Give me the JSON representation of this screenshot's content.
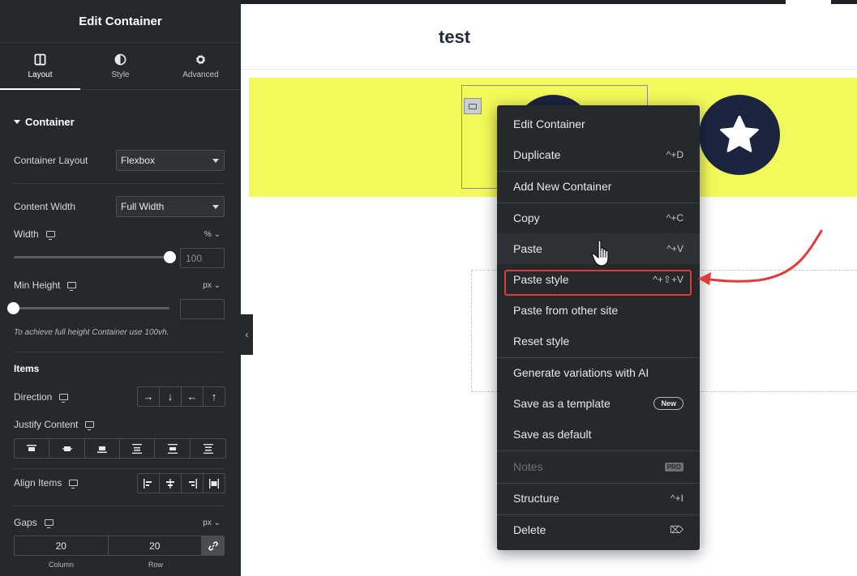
{
  "panel": {
    "title": "Edit Container",
    "tabs": [
      {
        "label": "Layout",
        "icon": "layout-icon"
      },
      {
        "label": "Style",
        "icon": "half-circle-icon"
      },
      {
        "label": "Advanced",
        "icon": "gear-icon"
      }
    ],
    "section": "Container",
    "container_layout": {
      "label": "Container Layout",
      "value": "Flexbox"
    },
    "content_width": {
      "label": "Content Width",
      "value": "Full Width"
    },
    "width": {
      "label": "Width",
      "unit": "%",
      "value": "100",
      "slider_fraction": 1.0
    },
    "min_height": {
      "label": "Min Height",
      "unit": "px",
      "value": "",
      "slider_fraction": 0.0
    },
    "hint": "To achieve full height Container use 100vh.",
    "items_heading": "Items",
    "direction_label": "Direction",
    "direction_options": [
      "→",
      "↓",
      "←",
      "↑"
    ],
    "justify_label": "Justify Content",
    "align_label": "Align Items",
    "gaps": {
      "label": "Gaps",
      "unit": "px",
      "column": "20",
      "row": "20",
      "column_label": "Column",
      "row_label": "Row"
    }
  },
  "canvas": {
    "page_title": "test"
  },
  "context_menu": {
    "items": [
      {
        "label": "Edit Container",
        "shortcut": ""
      },
      {
        "label": "Duplicate",
        "shortcut": "^+D"
      },
      {
        "label": "Add New Container",
        "shortcut": ""
      },
      {
        "label": "Copy",
        "shortcut": "^+C"
      },
      {
        "label": "Paste",
        "shortcut": "^+V"
      },
      {
        "label": "Paste style",
        "shortcut": "^+⇧+V"
      },
      {
        "label": "Paste from other site",
        "shortcut": ""
      },
      {
        "label": "Reset style",
        "shortcut": ""
      },
      {
        "label": "Generate variations with AI",
        "shortcut": ""
      },
      {
        "label": "Save as a template",
        "badge": "New"
      },
      {
        "label": "Save as default",
        "shortcut": ""
      },
      {
        "label": "Notes",
        "badge": "PRO"
      },
      {
        "label": "Structure",
        "shortcut": "^+I"
      },
      {
        "label": "Delete",
        "shortcut": "⌦"
      }
    ]
  },
  "colors": {
    "panel_bg": "#26292c",
    "highlight": "#e03b3b",
    "yellow_section": "#f2f95a",
    "icon_circle": "#1c2540"
  }
}
